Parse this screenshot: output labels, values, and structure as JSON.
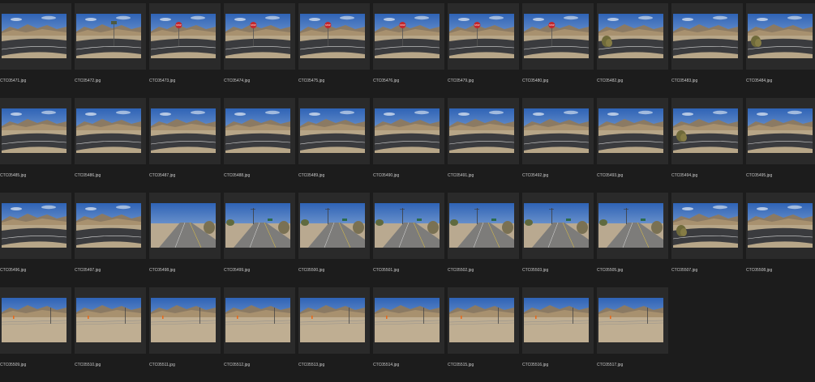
{
  "window": {
    "background": "#1c1c1c",
    "tile_background": "#2a2a2a",
    "label_color": "#c8c8c8"
  },
  "thumbnails": [
    {
      "filename": "CTC05471.jpg",
      "scene": "desert-road"
    },
    {
      "filename": "CTC05472.jpg",
      "scene": "desert-road-sign"
    },
    {
      "filename": "CTC05473.jpg",
      "scene": "stop-sign"
    },
    {
      "filename": "CTC05474.jpg",
      "scene": "stop-sign"
    },
    {
      "filename": "CTC05475.jpg",
      "scene": "stop-sign"
    },
    {
      "filename": "CTC05476.jpg",
      "scene": "stop-sign"
    },
    {
      "filename": "CTC05479.jpg",
      "scene": "stop-sign"
    },
    {
      "filename": "CTC05480.jpg",
      "scene": "stop-sign"
    },
    {
      "filename": "CTC05482.jpg",
      "scene": "desert-road-shrub"
    },
    {
      "filename": "CTC05483.jpg",
      "scene": "desert-road"
    },
    {
      "filename": "CTC05484.jpg",
      "scene": "desert-road-shrub"
    },
    {
      "filename": "CTC05485.jpg",
      "scene": "desert-road"
    },
    {
      "filename": "CTC05486.jpg",
      "scene": "desert-road"
    },
    {
      "filename": "CTC05487.jpg",
      "scene": "desert-road"
    },
    {
      "filename": "CTC05488.jpg",
      "scene": "desert-road"
    },
    {
      "filename": "CTC05489.jpg",
      "scene": "desert-road"
    },
    {
      "filename": "CTC05490.jpg",
      "scene": "desert-road"
    },
    {
      "filename": "CTC05491.jpg",
      "scene": "desert-road"
    },
    {
      "filename": "CTC05492.jpg",
      "scene": "desert-road"
    },
    {
      "filename": "CTC05493.jpg",
      "scene": "desert-road"
    },
    {
      "filename": "CTC05494.jpg",
      "scene": "desert-road-shrub"
    },
    {
      "filename": "CTC05495.jpg",
      "scene": "desert-road"
    },
    {
      "filename": "CTC05496.jpg",
      "scene": "desert-road"
    },
    {
      "filename": "CTC05497.jpg",
      "scene": "desert-road"
    },
    {
      "filename": "CTC05498.jpg",
      "scene": "highway"
    },
    {
      "filename": "CTC05499.jpg",
      "scene": "highway-pole"
    },
    {
      "filename": "CTC05500.jpg",
      "scene": "highway-pole"
    },
    {
      "filename": "CTC05501.jpg",
      "scene": "highway-pole"
    },
    {
      "filename": "CTC05502.jpg",
      "scene": "highway-pole"
    },
    {
      "filename": "CTC05503.jpg",
      "scene": "highway-pole"
    },
    {
      "filename": "CTC05505.jpg",
      "scene": "highway-pole"
    },
    {
      "filename": "CTC05507.jpg",
      "scene": "desert-road-shrub"
    },
    {
      "filename": "CTC05508.jpg",
      "scene": "desert-road"
    },
    {
      "filename": "CTC05509.jpg",
      "scene": "dirt-lot-fence"
    },
    {
      "filename": "CTC05510.jpg",
      "scene": "dirt-lot-fence"
    },
    {
      "filename": "CTC05511.jpg",
      "scene": "dirt-lot-fence"
    },
    {
      "filename": "CTC05512.jpg",
      "scene": "dirt-lot-fence"
    },
    {
      "filename": "CTC05513.jpg",
      "scene": "dirt-lot-fence"
    },
    {
      "filename": "CTC05514.jpg",
      "scene": "dirt-lot-fence"
    },
    {
      "filename": "CTC05515.jpg",
      "scene": "dirt-lot-fence"
    },
    {
      "filename": "CTC05516.jpg",
      "scene": "dirt-lot-fence"
    },
    {
      "filename": "CTC05517.jpg",
      "scene": "dirt-lot-fence"
    }
  ]
}
